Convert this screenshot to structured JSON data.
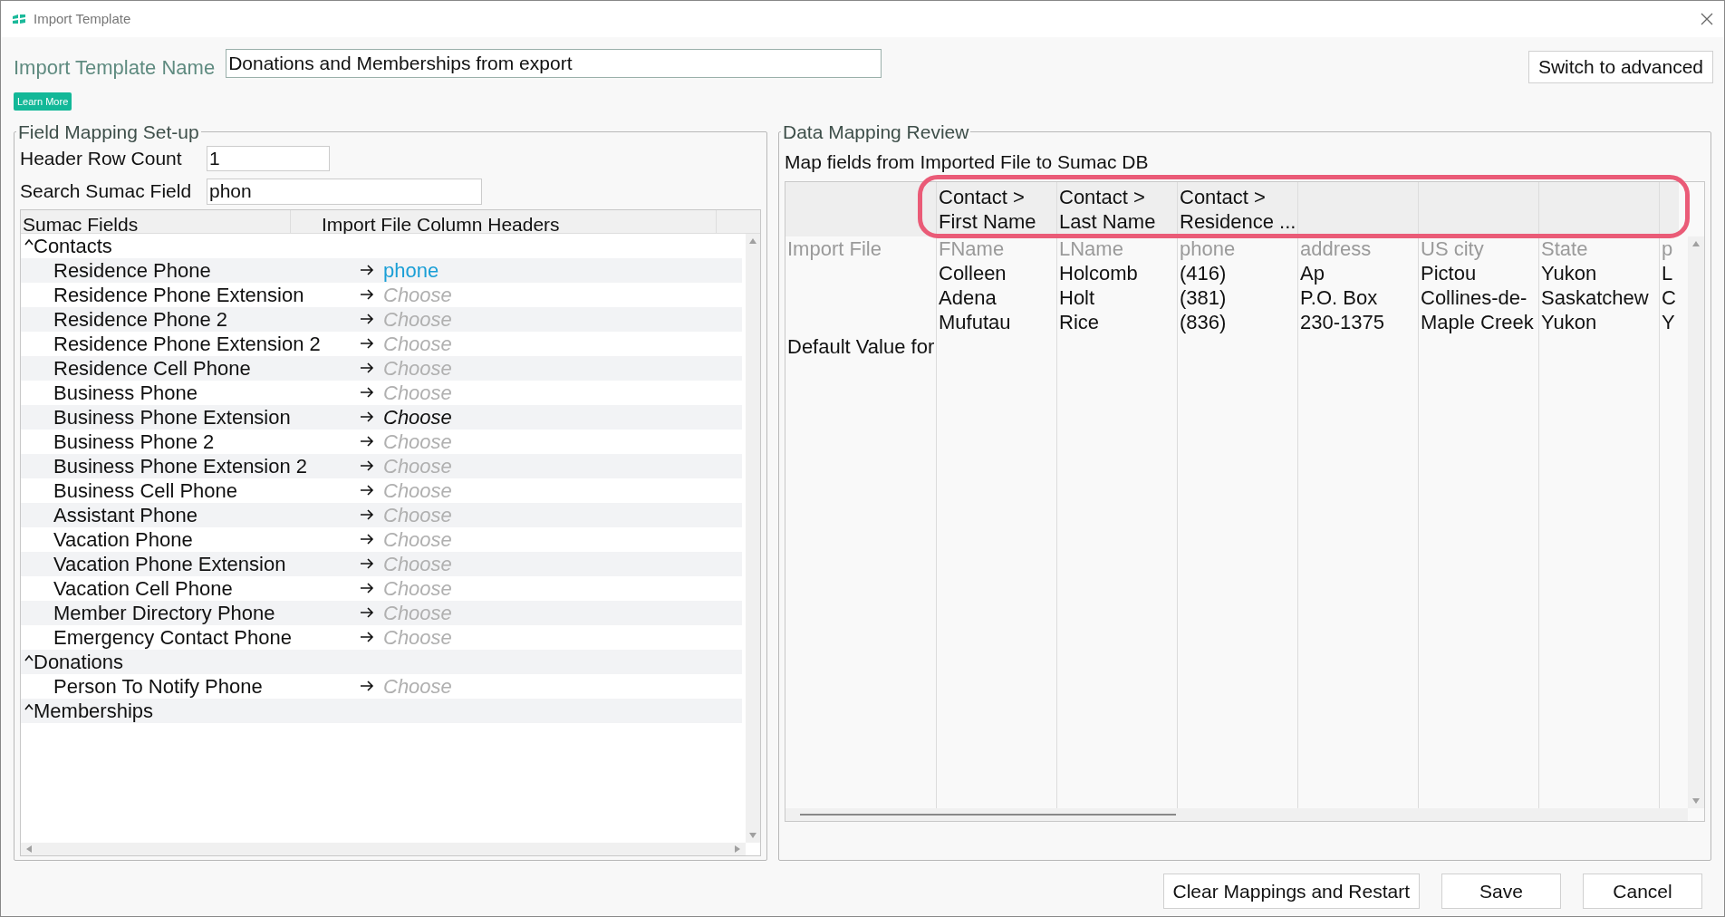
{
  "window": {
    "title": "Import Template"
  },
  "template_name": {
    "label": "Import Template Name",
    "value": "Donations and Memberships from export"
  },
  "learn_more": "Learn More",
  "switch_button": "Switch to advanced",
  "field_mapping": {
    "title": "Field Mapping Set-up",
    "header_row_count": {
      "label": "Header Row Count",
      "value": "1"
    },
    "search": {
      "label": "Search Sumac Field",
      "value": "phon"
    },
    "columns": [
      "Sumac Fields",
      "Import File Column Headers"
    ],
    "groups": [
      {
        "label": "Contacts",
        "expanded": true,
        "children": [
          {
            "label": "Residence Phone",
            "target": "phone",
            "kind": "mapped"
          },
          {
            "label": "Residence Phone Extension",
            "target": "Choose",
            "kind": "unmapped"
          },
          {
            "label": "Residence Phone 2",
            "target": "Choose",
            "kind": "unmapped"
          },
          {
            "label": "Residence Phone Extension 2",
            "target": "Choose",
            "kind": "unmapped"
          },
          {
            "label": "Residence Cell Phone",
            "target": "Choose",
            "kind": "unmapped"
          },
          {
            "label": "Business Phone",
            "target": "Choose",
            "kind": "unmapped"
          },
          {
            "label": "Business Phone Extension",
            "target": "Choose",
            "kind": "hovered"
          },
          {
            "label": "Business Phone 2",
            "target": "Choose",
            "kind": "unmapped"
          },
          {
            "label": "Business Phone Extension 2",
            "target": "Choose",
            "kind": "unmapped"
          },
          {
            "label": "Business Cell Phone",
            "target": "Choose",
            "kind": "unmapped"
          },
          {
            "label": "Assistant Phone",
            "target": "Choose",
            "kind": "unmapped"
          },
          {
            "label": "Vacation Phone",
            "target": "Choose",
            "kind": "unmapped"
          },
          {
            "label": "Vacation Phone Extension",
            "target": "Choose",
            "kind": "unmapped"
          },
          {
            "label": "Vacation Cell Phone",
            "target": "Choose",
            "kind": "unmapped"
          },
          {
            "label": "Member Directory Phone",
            "target": "Choose",
            "kind": "unmapped"
          },
          {
            "label": "Emergency Contact Phone",
            "target": "Choose",
            "kind": "unmapped"
          }
        ]
      },
      {
        "label": "Donations",
        "expanded": true,
        "children": [
          {
            "label": "Person To Notify Phone",
            "target": "Choose",
            "kind": "unmapped"
          }
        ]
      },
      {
        "label": "Memberships",
        "expanded": true
      }
    ]
  },
  "data_review": {
    "title": "Data Mapping Review",
    "instruction": "Map fields from Imported File to Sumac DB",
    "highlight_headers": true,
    "row_labels": {
      "import_file": "Import File",
      "default_value": "Default Value for"
    },
    "columns": [
      {
        "mapping": [
          "Contact >",
          "First Name"
        ],
        "header": "FName",
        "samples": [
          "Colleen",
          "Adena",
          "Mufutau"
        ]
      },
      {
        "mapping": [
          "Contact >",
          "Last Name"
        ],
        "header": "LName",
        "samples": [
          "Holcomb",
          "Holt",
          "Rice"
        ]
      },
      {
        "mapping": [
          "Contact >",
          "Residence ..."
        ],
        "header": "phone",
        "samples": [
          "(416)",
          "(381)",
          "(836)"
        ]
      },
      {
        "header": "address",
        "samples": [
          "Ap",
          "P.O. Box",
          "230-1375"
        ]
      },
      {
        "header": "US city",
        "samples": [
          "Pictou",
          "Collines-de-",
          "Maple Creek"
        ]
      },
      {
        "header": "State",
        "samples": [
          "Yukon",
          "Saskatchew",
          "Yukon"
        ]
      },
      {
        "header": "p",
        "samples": [
          "L",
          "C",
          "Y"
        ],
        "partial": true
      }
    ]
  },
  "buttons": [
    "Clear Mappings and Restart",
    "Save",
    "Cancel"
  ]
}
